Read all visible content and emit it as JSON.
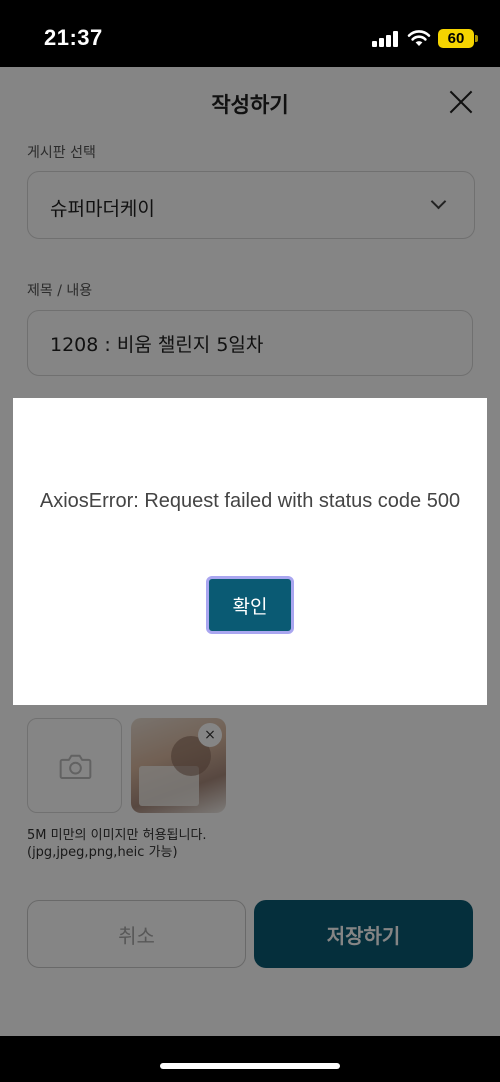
{
  "status_bar": {
    "time": "21:37",
    "battery": "60"
  },
  "header": {
    "title": "작성하기",
    "close_icon": "close-icon"
  },
  "board": {
    "label": "게시판 선택",
    "selected": "슈퍼마더케이"
  },
  "content": {
    "label": "제목 / 내용",
    "title_value": "1208 : 비움 챌린지 5일차"
  },
  "photos": {
    "add_icon": "camera-icon",
    "remove_glyph": "×",
    "help_line1": "5M 미만의 이미지만 허용됩니다.",
    "help_line2": "(jpg,jpeg,png,heic 가능)"
  },
  "actions": {
    "cancel_label": "취소",
    "save_label": "저장하기"
  },
  "modal": {
    "message": "AxiosError: Request failed with status code 500",
    "ok_label": "확인"
  },
  "colors": {
    "primary": "#0a5a73",
    "focus_ring": "#a9a6f0",
    "battery": "#f5d400"
  }
}
